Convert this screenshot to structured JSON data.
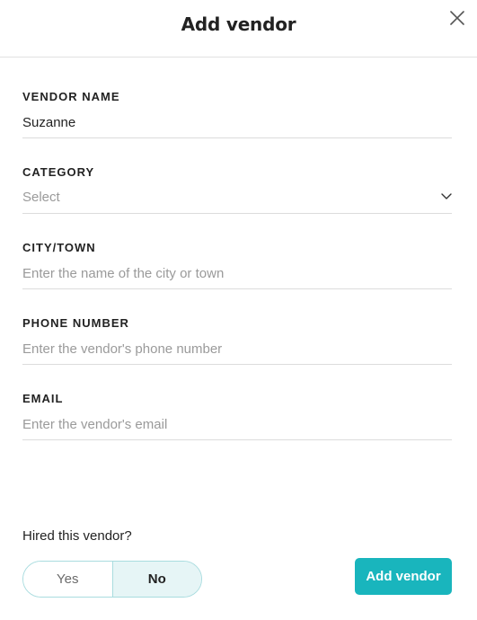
{
  "modal": {
    "title": "Add vendor"
  },
  "fields": {
    "vendor_name": {
      "label": "VENDOR NAME",
      "value": "Suzanne"
    },
    "category": {
      "label": "CATEGORY",
      "selected": "Select"
    },
    "city": {
      "label": "CITY/TOWN",
      "placeholder": "Enter the name of the city or town"
    },
    "phone": {
      "label": "PHONE NUMBER",
      "placeholder": "Enter the vendor's phone number"
    },
    "email": {
      "label": "EMAIL",
      "placeholder": "Enter the vendor's email"
    }
  },
  "hired": {
    "question": "Hired this vendor?",
    "options": [
      "Yes",
      "No"
    ],
    "selected": "No"
  },
  "footer": {
    "submit_label": "Add vendor"
  },
  "icons": {
    "close": "close-icon",
    "dropdown": "chevron-down-icon"
  },
  "colors": {
    "accent": "#19b5bd",
    "toggle_selected_bg": "#e6f5f6",
    "toggle_border": "#a9dcdf"
  }
}
